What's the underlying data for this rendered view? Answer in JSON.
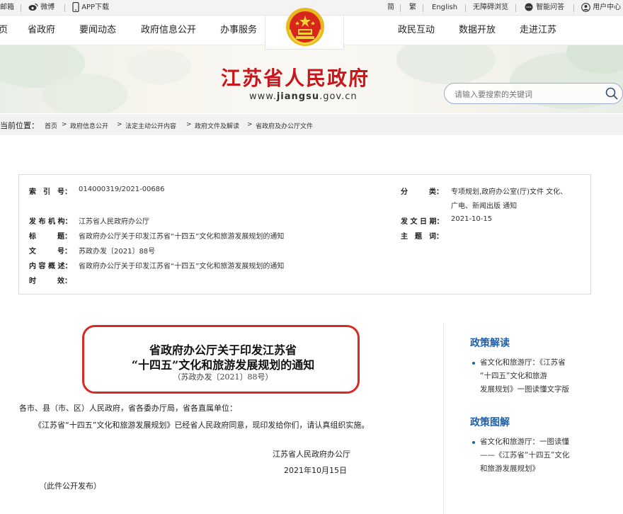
{
  "topbar": {
    "mail": "邮箱",
    "weibo": "微博",
    "app": "APP下载",
    "simplified": "简",
    "traditional": "繁",
    "english": "English",
    "accessibility": "无障碍浏览",
    "qa": "智能问答",
    "user_center": "用户中心"
  },
  "nav": {
    "items_left": [
      "页",
      "省政府",
      "要闻动态",
      "政府信息公开",
      "办事服务"
    ],
    "items_right": [
      "政民互动",
      "数据开放",
      "走进江苏"
    ]
  },
  "banner": {
    "site_title": "江苏省人民政府",
    "url_prefix": "www.",
    "url_bold": "jiangsu",
    "url_suffix": ".gov.cn"
  },
  "search": {
    "placeholder": "请输入要搜索的关键词"
  },
  "breadcrumb": {
    "lead": "当前位置：",
    "items": [
      "首页",
      "政府信息公开",
      "法定主动公开内容",
      "政府文件及解读",
      "省政府及办公厅文件"
    ],
    "separator": ">"
  },
  "info": {
    "index_label": "索　引　号：",
    "index_value": "014000319/2021-00686",
    "category_label": "分　　　类：",
    "category_value_1": "专项规划,政府办公室(厅)文件 文化、",
    "category_value_2": "广电、新闻出版 通知",
    "publisher_label": "发 布 机 构：",
    "publisher_value": "江苏省人民政府办公厅",
    "date_label": "发 文 日 期：",
    "date_value": "2021-10-15",
    "title_label": "标　　　题：",
    "title_value": "省政府办公厅关于印发江苏省“十四五”文化和旅游发展规划的通知",
    "subject_label": "主　题　词：",
    "subject_value": "",
    "docno_label": "文　　　号：",
    "docno_value": "苏政办发〔2021〕88号",
    "summary_label": "内 容 概 述：",
    "summary_value": "省政府办公厅关于印发江苏省“十四五”文化和旅游发展规划的通知",
    "validity_label": "时　　　效：",
    "validity_value": ""
  },
  "document": {
    "title_line1": "省政府办公厅关于印发江苏省",
    "title_line2": "“十四五”文化和旅游发展规划的通知",
    "doc_number": "（苏政办发〔2021〕88号）",
    "salutation": "各市、县（市、区）人民政府，省各委办厅局，省各直属单位：",
    "paragraph": "《江苏省“十四五”文化和旅游发展规划》已经省人民政府同意，现印发给你们，请认真组织实施。",
    "signer": "江苏省人民政府办公厅",
    "sign_date": "2021年10月15日",
    "note": "（此件公开发布）"
  },
  "sidebar": {
    "section1_title": "政策解读",
    "section1_lines": [
      "省文化和旅游厅：《江苏省",
      "“十四五”文化和旅游",
      "发展规划》一图读懂文字版"
    ],
    "section2_title": "政策图解",
    "section2_lines": [
      "省文化和旅游厅：一图读懂",
      "——《江苏省“十四五”文化",
      "和旅游发展规划》"
    ]
  },
  "colors": {
    "brand_red": "#c8161d",
    "highlight_red": "#d62a24",
    "link_blue": "#1f5fa8"
  }
}
